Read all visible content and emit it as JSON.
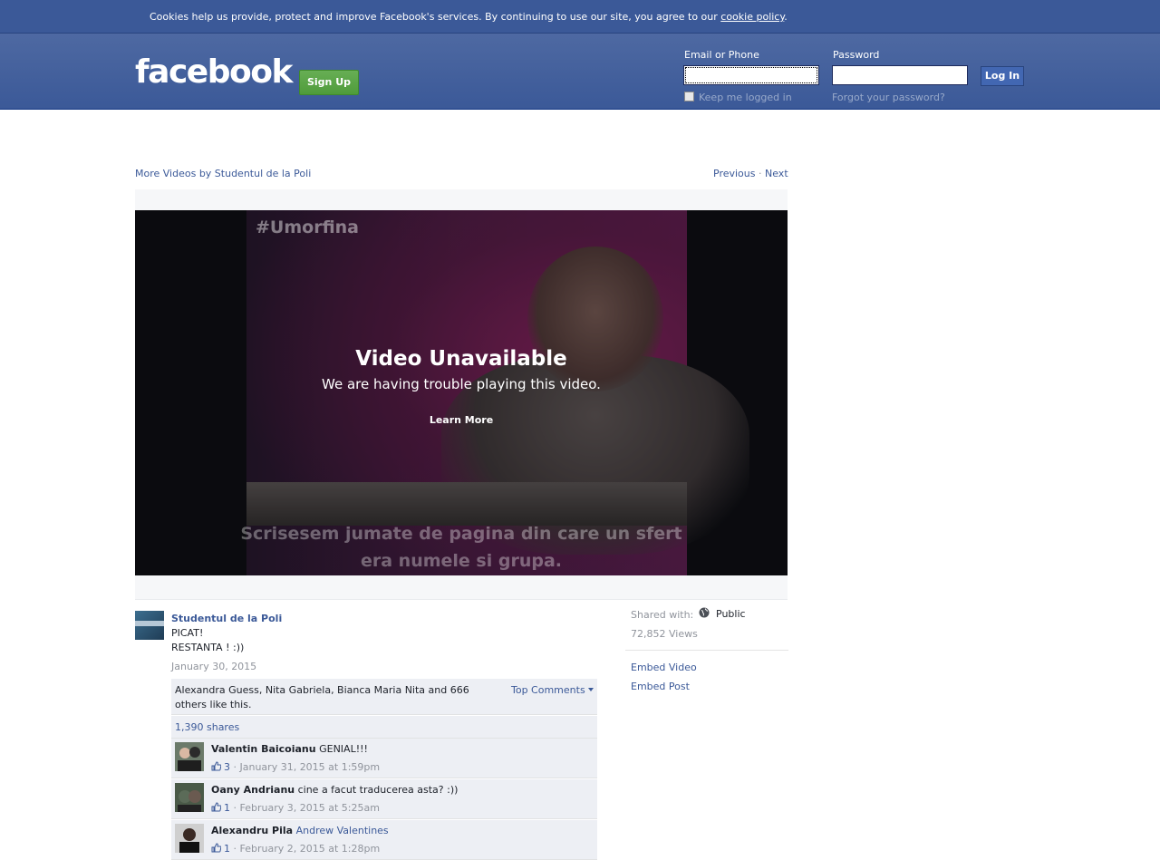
{
  "cookie_banner": {
    "text": "Cookies help us provide, protect and improve Facebook's services. By continuing to use our site, you agree to our ",
    "link": "cookie policy",
    "end": "."
  },
  "header": {
    "logo": "facebook",
    "signup": "Sign Up",
    "email_label": "Email or Phone",
    "email_value": "",
    "password_label": "Password",
    "password_value": "",
    "login": "Log In",
    "keep_logged": "Keep me logged in",
    "forgot": "Forgot your password?"
  },
  "video_nav": {
    "more_videos": "More Videos by Studentul de la Poli",
    "previous": "Previous",
    "separator": "·",
    "next": "Next"
  },
  "video": {
    "tag": "#Umorfina",
    "subtitle_line1": "Scrisesem jumate de pagina din care un sfert",
    "subtitle_line2": "era numele si grupa.",
    "title": "Video Unavailable",
    "description": "We are having trouble playing this video.",
    "learn_more": "Learn More"
  },
  "post": {
    "author": "Studentul de la Poli",
    "line1": "PICAT!",
    "line2": "RESTANTA ! :))",
    "date": "January 30, 2015",
    "likes": "Alexandra Guess, Nita Gabriela, Bianca Maria Nita and 666 others like this.",
    "top_comments": "Top Comments",
    "shares": "1,390 shares",
    "comments": [
      {
        "name": "Valentin Baicoianu",
        "text": "GENIAL!!!",
        "mention": "",
        "likes": "3",
        "time": "January 31, 2015 at 1:59pm"
      },
      {
        "name": "Oany Andrianu",
        "text": "cine a facut traducerea asta? :))",
        "mention": "",
        "likes": "1",
        "time": "February 3, 2015 at 5:25am"
      },
      {
        "name": "Alexandru Pila",
        "text": "",
        "mention": "Andrew Valentines",
        "likes": "1",
        "time": "February 2, 2015 at 1:28pm"
      }
    ]
  },
  "sidebar": {
    "shared_with": "Shared with:",
    "audience": "Public",
    "views": "72,852 Views",
    "embed_video": "Embed Video",
    "embed_post": "Embed Post"
  },
  "icons": {
    "globe": "globe-icon",
    "thumb": "like-thumb-icon",
    "caret": "caret-down-icon"
  },
  "colors": {
    "brand": "#3b5998",
    "signup_green": "#4f9c3b",
    "panel_bg": "#edeff4"
  }
}
